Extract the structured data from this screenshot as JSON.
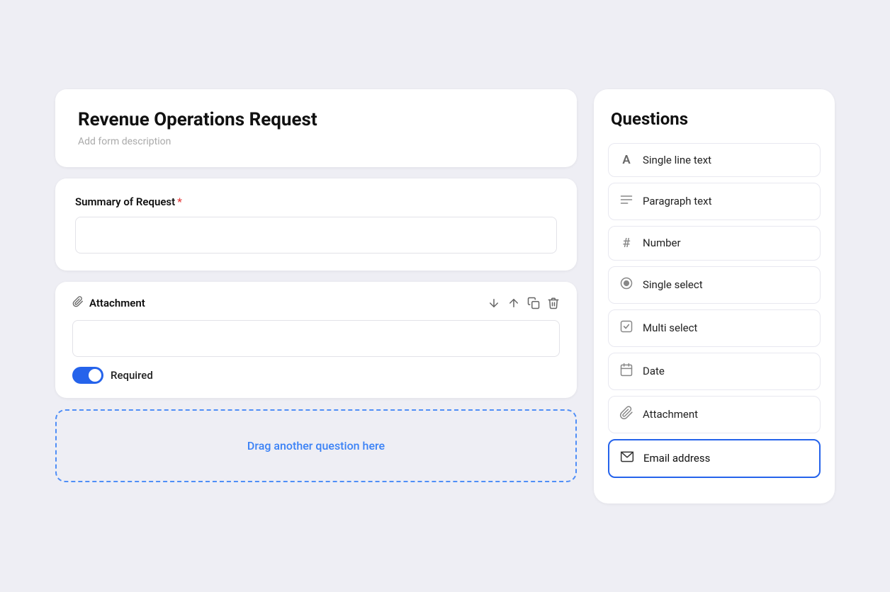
{
  "form": {
    "title": "Revenue Operations Request",
    "description": "Add form description",
    "summary_field": {
      "label": "Summary of Request",
      "required": true,
      "placeholder": ""
    },
    "attachment_field": {
      "label": "Attachment",
      "required_label": "Required",
      "is_required": true,
      "placeholder": ""
    },
    "drag_zone_text": "Drag another question here"
  },
  "questions": {
    "title": "Questions",
    "items": [
      {
        "id": "single-line-text",
        "label": "Single line text",
        "icon": "A"
      },
      {
        "id": "paragraph-text",
        "label": "Paragraph text",
        "icon": "¶"
      },
      {
        "id": "number",
        "label": "Number",
        "icon": "#"
      },
      {
        "id": "single-select",
        "label": "Single select",
        "icon": "⊙"
      },
      {
        "id": "multi-select",
        "label": "Multi select",
        "icon": "☑"
      },
      {
        "id": "date",
        "label": "Date",
        "icon": "📅"
      },
      {
        "id": "attachment",
        "label": "Attachment",
        "icon": "🔗"
      },
      {
        "id": "email-address",
        "label": "Email address",
        "icon": "✉"
      }
    ]
  }
}
